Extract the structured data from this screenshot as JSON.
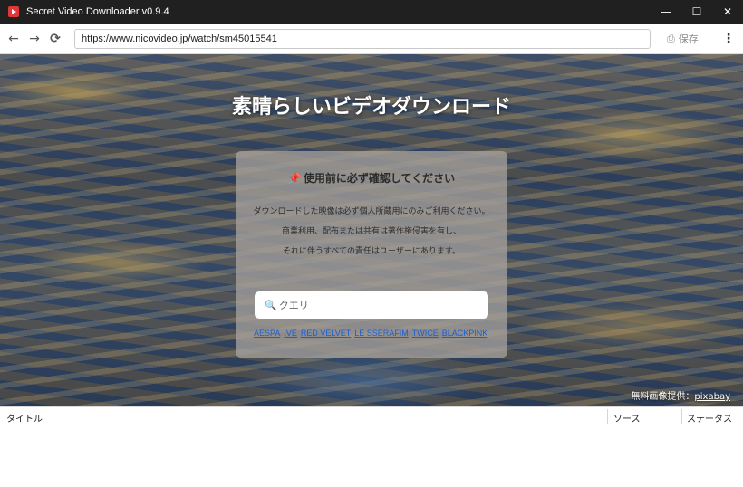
{
  "window": {
    "title": "Secret Video Downloader v0.9.4",
    "controls": {
      "minimize": "—",
      "maximize": "☐",
      "close": "✕"
    }
  },
  "toolbar": {
    "back_icon": "←",
    "forward_icon": "→",
    "reload_icon": "⟳",
    "url": "https://www.nicovideo.jp/watch/sm45015541",
    "save_label": "保存",
    "save_icon": "⎙",
    "menu_icon": "⋮"
  },
  "hero": {
    "title": "素晴らしいビデオダウンロード",
    "notice": {
      "icon": "📌",
      "title": "使用前に必ず確認してください",
      "lines": [
        "ダウンロードした映像は必ず個人所蔵用にのみご利用ください。",
        "商業利用、配布または共有は著作権侵害を有し、",
        "それに伴うすべての責任はユーザーにあります。"
      ]
    },
    "search": {
      "icon": "🔍",
      "placeholder": "クエリ"
    },
    "quick_links": [
      "AESPA",
      "IVE",
      "RED VELVET",
      "LE SSERAFIM",
      "TWICE",
      "BLACKPINK"
    ],
    "credit": {
      "text": "無料画像提供：",
      "link": "pixabay"
    }
  },
  "table": {
    "columns": [
      "タイトル",
      "ソース",
      "ステータス"
    ]
  }
}
